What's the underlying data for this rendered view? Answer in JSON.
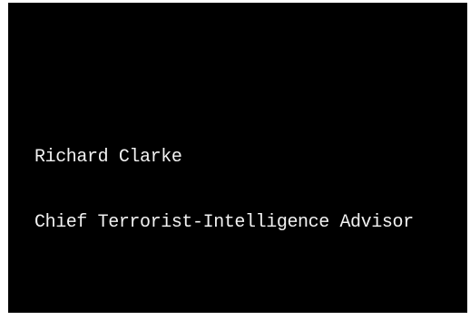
{
  "caption": {
    "name": "Richard Clarke",
    "title": "Chief Terrorist-Intelligence Advisor"
  },
  "colors": {
    "background": "#000000",
    "text": "#f2f2f2"
  }
}
